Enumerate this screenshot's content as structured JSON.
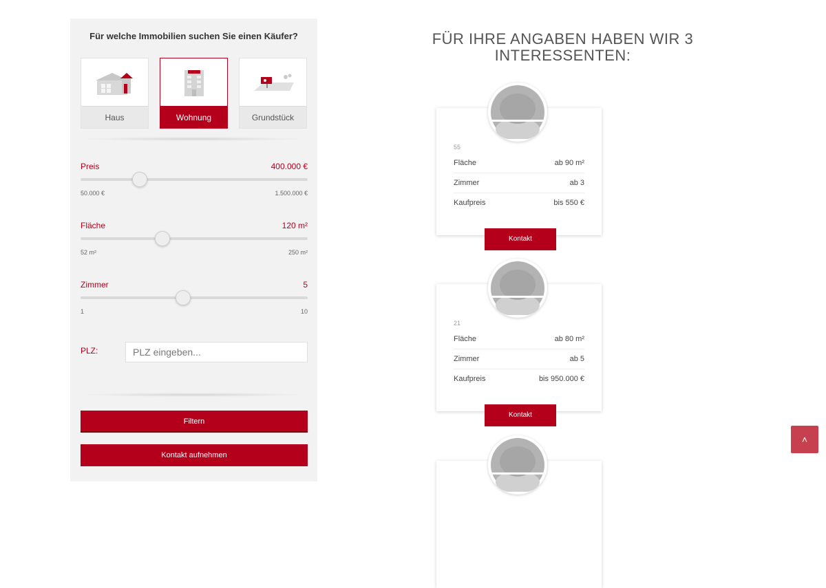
{
  "filter": {
    "title": "Für welche Immobilien suchen Sie einen Käufer?",
    "types": [
      {
        "label": "Haus",
        "icon": "house-icon",
        "active": false
      },
      {
        "label": "Wohnung",
        "icon": "apartment-building-icon",
        "active": true
      },
      {
        "label": "Grundstück",
        "icon": "land-plot-icon",
        "active": false
      }
    ],
    "price": {
      "label": "Preis",
      "value": "400.000 €",
      "min": "50.000 €",
      "max": "1.500.000 €",
      "fraction": 0.26
    },
    "area": {
      "label": "Fläche",
      "value": "120 m²",
      "min": "52 m²",
      "max": "250 m²",
      "fraction": 0.36
    },
    "rooms": {
      "label": "Zimmer",
      "value": "5",
      "min": "1",
      "max": "10",
      "fraction": 0.45
    },
    "plz": {
      "label": "PLZ:",
      "placeholder": "PLZ eingeben...",
      "value": ""
    },
    "filter_button": "Filtern",
    "contact_button": "Kontakt aufnehmen"
  },
  "results": {
    "title": "FÜR IHRE ANGABEN HABEN WIR 3 INTERESSENTEN:",
    "prospects": [
      {
        "id": "55",
        "rows": [
          {
            "label": "Fläche",
            "value": "ab 90 m²"
          },
          {
            "label": "Zimmer",
            "value": "ab 3"
          },
          {
            "label": "Kaufpreis",
            "value": "bis 550 €"
          }
        ],
        "button": "Kontakt"
      },
      {
        "id": "21",
        "rows": [
          {
            "label": "Fläche",
            "value": "ab 80 m²"
          },
          {
            "label": "Zimmer",
            "value": "ab 5"
          },
          {
            "label": "Kaufpreis",
            "value": "bis 950.000 €"
          }
        ],
        "button": "Kontakt"
      }
    ]
  },
  "colors": {
    "accent": "#b5001b",
    "scroll_button": "#c7404f",
    "panel_bg": "#f2f2f2"
  },
  "scroll_top": {
    "icon": "chevron-up-icon",
    "glyph": "˄"
  }
}
